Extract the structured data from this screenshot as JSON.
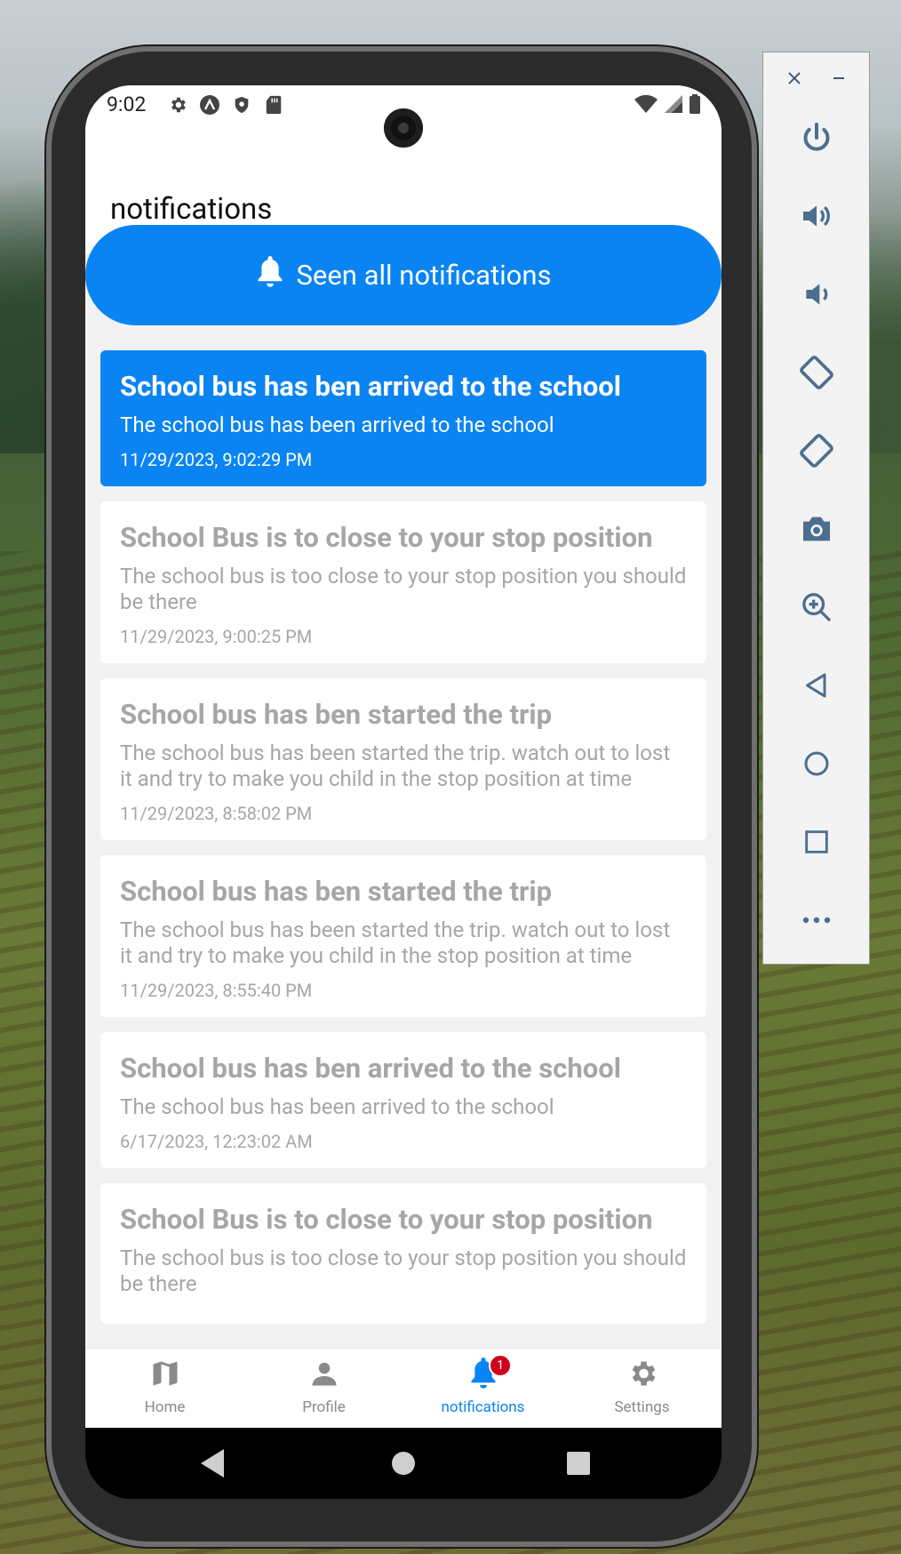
{
  "status_bar": {
    "time": "9:02"
  },
  "header": {
    "title": "notifications"
  },
  "seen_all": {
    "label": "Seen all notifications"
  },
  "notifications": [
    {
      "title": "School bus has ben arrived to the school",
      "body": "The school bus has been arrived to the school",
      "date": "11/29/2023, 9:02:29 PM",
      "unread": true
    },
    {
      "title": "School Bus is to close to your stop position",
      "body": "The school bus is too close to your stop position you should be there",
      "date": "11/29/2023, 9:00:25 PM",
      "unread": false
    },
    {
      "title": "School bus has ben started the trip",
      "body": "The school bus has been started the trip. watch out to lost it and try to make you child in the stop position at time",
      "date": "11/29/2023, 8:58:02 PM",
      "unread": false
    },
    {
      "title": "School bus has ben started the trip",
      "body": "The school bus has been started the trip. watch out to lost it and try to make you child in the stop position at time",
      "date": "11/29/2023, 8:55:40 PM",
      "unread": false
    },
    {
      "title": "School bus has ben arrived to the school",
      "body": "The school bus has been arrived to the school",
      "date": "6/17/2023, 12:23:02 AM",
      "unread": false
    },
    {
      "title": "School Bus is to close to your stop position",
      "body": "The school bus is too close to your stop position you should be there",
      "date": "",
      "unread": false
    }
  ],
  "bottom_nav": {
    "items": [
      {
        "label": "Home",
        "icon": "map-icon"
      },
      {
        "label": "Profile",
        "icon": "person-icon"
      },
      {
        "label": "notifications",
        "icon": "bell-icon",
        "badge": "1"
      },
      {
        "label": "Settings",
        "icon": "gear-icon"
      }
    ],
    "active_index": 2
  },
  "colors": {
    "accent": "#0a84f2",
    "badge": "#d0021b",
    "muted_text": "#a6a6a6"
  },
  "emulator_toolbar": {
    "buttons": [
      "close-icon",
      "minimize-icon",
      "power-icon",
      "volume-up-icon",
      "volume-down-icon",
      "rotate-left-icon",
      "rotate-right-icon",
      "camera-icon",
      "zoom-icon",
      "back-icon",
      "home-icon",
      "overview-icon",
      "more-icon"
    ]
  }
}
